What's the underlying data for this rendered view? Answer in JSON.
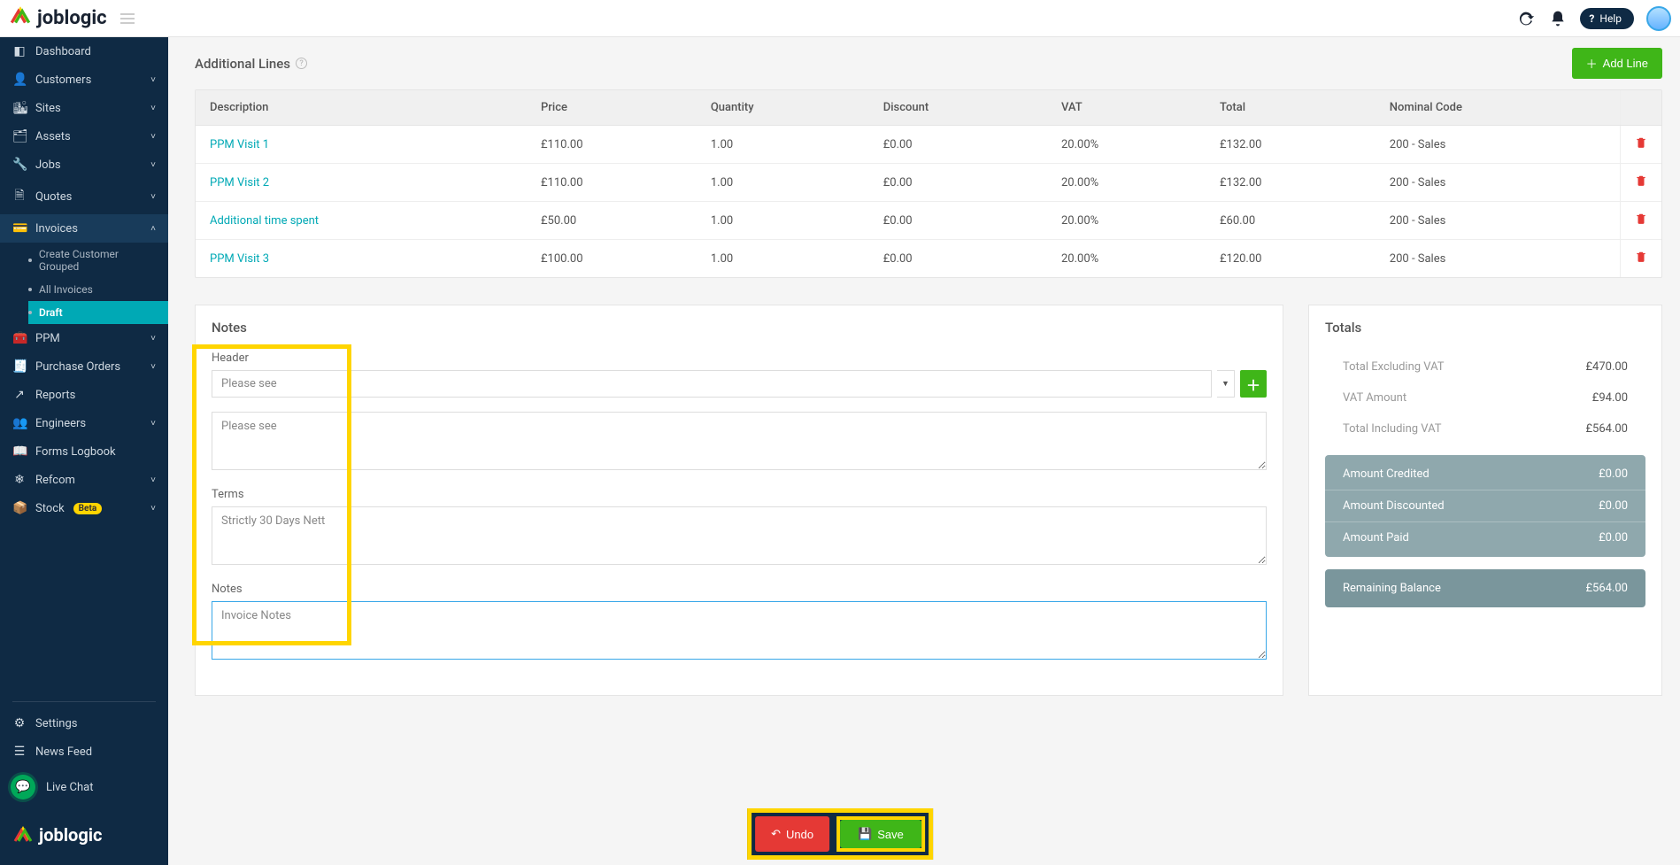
{
  "app": {
    "name": "joblogic",
    "help_label": "Help"
  },
  "sidebar": {
    "items": [
      {
        "icon": "▦",
        "label": "Dashboard"
      },
      {
        "icon": "👤",
        "label": "Customers",
        "expandable": true
      },
      {
        "icon": "🏢",
        "label": "Sites",
        "expandable": true
      },
      {
        "icon": "🗂",
        "label": "Assets",
        "expandable": true
      },
      {
        "icon": "🔧",
        "label": "Jobs",
        "expandable": true
      },
      {
        "icon": "🗎",
        "label": "Quotes",
        "expandable": true
      },
      {
        "icon": "💳",
        "label": "Invoices",
        "expandable": true,
        "expanded": true,
        "active_parent": true,
        "children": [
          {
            "label": "Create Customer Grouped"
          },
          {
            "label": "All Invoices"
          },
          {
            "label": "Draft",
            "active": true
          }
        ]
      },
      {
        "icon": "🧰",
        "label": "PPM",
        "expandable": true
      },
      {
        "icon": "🧾",
        "label": "Purchase Orders",
        "expandable": true
      },
      {
        "icon": "↗",
        "label": "Reports"
      },
      {
        "icon": "👥",
        "label": "Engineers",
        "expandable": true
      },
      {
        "icon": "📖",
        "label": "Forms Logbook"
      },
      {
        "icon": "❄",
        "label": "Refcom",
        "expandable": true
      },
      {
        "icon": "📦",
        "label": "Stock",
        "badge": "Beta",
        "expandable": true
      }
    ],
    "settings_label": "Settings",
    "newsfeed_label": "News Feed",
    "livechat_label": "Live Chat"
  },
  "additional_lines": {
    "title": "Additional Lines",
    "add_button": "Add Line",
    "columns": [
      "Description",
      "Price",
      "Quantity",
      "Discount",
      "VAT",
      "Total",
      "Nominal Code"
    ],
    "rows": [
      {
        "description": "PPM Visit 1",
        "price": "£110.00",
        "quantity": "1.00",
        "discount": "£0.00",
        "vat": "20.00%",
        "total": "£132.00",
        "nominal": "200 - Sales"
      },
      {
        "description": "PPM Visit 2",
        "price": "£110.00",
        "quantity": "1.00",
        "discount": "£0.00",
        "vat": "20.00%",
        "total": "£132.00",
        "nominal": "200 - Sales"
      },
      {
        "description": "Additional time spent",
        "price": "£50.00",
        "quantity": "1.00",
        "discount": "£0.00",
        "vat": "20.00%",
        "total": "£60.00",
        "nominal": "200 - Sales"
      },
      {
        "description": "PPM Visit 3",
        "price": "£100.00",
        "quantity": "1.00",
        "discount": "£0.00",
        "vat": "20.00%",
        "total": "£120.00",
        "nominal": "200 - Sales"
      }
    ]
  },
  "notes": {
    "title": "Notes",
    "header_label": "Header",
    "header_select_value": "Please see",
    "header_textarea_value": "Please see",
    "terms_label": "Terms",
    "terms_value": "Strictly 30 Days Nett",
    "notes_label": "Notes",
    "notes_value": "Invoice Notes"
  },
  "totals": {
    "title": "Totals",
    "rows_light": [
      {
        "label": "Total Excluding VAT",
        "value": "£470.00"
      },
      {
        "label": "VAT Amount",
        "value": "£94.00"
      },
      {
        "label": "Total Including VAT",
        "value": "£564.00"
      }
    ],
    "rows_grey": [
      {
        "label": "Amount Credited",
        "value": "£0.00"
      },
      {
        "label": "Amount Discounted",
        "value": "£0.00"
      },
      {
        "label": "Amount Paid",
        "value": "£0.00"
      }
    ],
    "balance": {
      "label": "Remaining Balance",
      "value": "£564.00"
    }
  },
  "actions": {
    "undo": "Undo",
    "save": "Save"
  }
}
